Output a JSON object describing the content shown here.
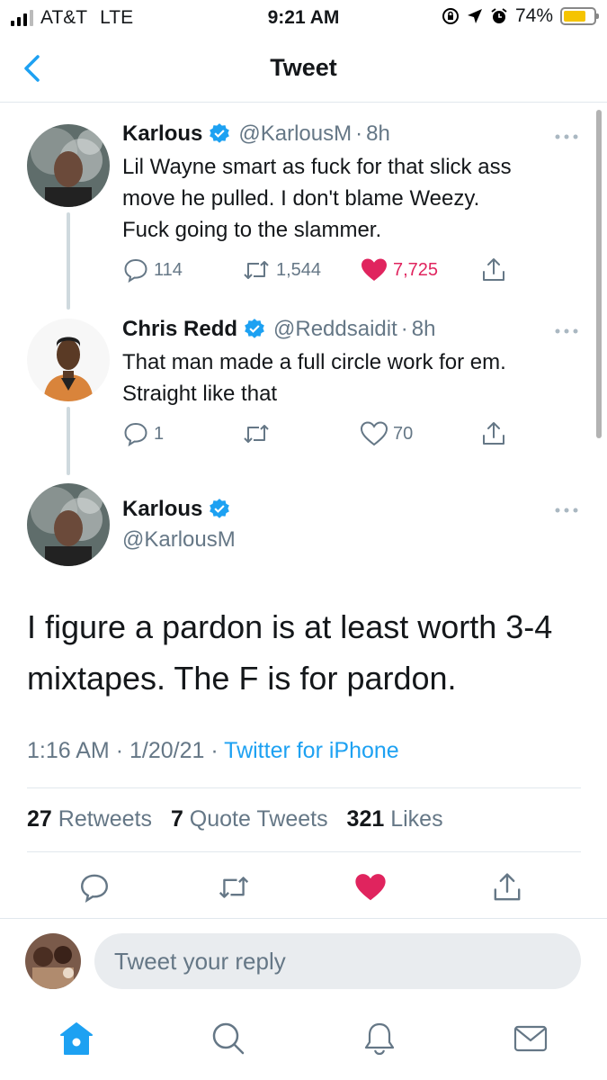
{
  "status_bar": {
    "carrier": "AT&T",
    "network": "LTE",
    "time": "9:21 AM",
    "battery": "74%"
  },
  "header": {
    "title": "Tweet",
    "back_icon": "chevron-left-icon"
  },
  "colors": {
    "accent": "#1da1f2",
    "like": "#e0245e",
    "secondary_text": "#657786",
    "primary_text": "#14171a"
  },
  "thread": [
    {
      "name": "Karlous",
      "handle": "@KarlousM",
      "separator": "·",
      "time": "8h",
      "text_lines": [
        "Lil Wayne smart as fuck for that slick ass",
        "move he pulled. I don't blame Weezy.",
        "Fuck going to the slammer."
      ],
      "replies": "114",
      "retweets": "1,544",
      "likes": "7,725",
      "liked": true
    },
    {
      "name": "Chris Redd",
      "handle": "@Reddsaidit",
      "separator": "·",
      "time": "8h",
      "text_lines": [
        "That man made a full circle work for em.",
        "Straight like that"
      ],
      "replies": "1",
      "retweets": "",
      "likes": "70",
      "liked": false
    }
  ],
  "main_tweet": {
    "name": "Karlous",
    "handle": "@KarlousM",
    "text_lines": [
      "I figure a pardon is at least worth 3-4",
      "mixtapes. The F is for pardon."
    ],
    "time": "1:16 AM",
    "date": "1/20/21",
    "separator": "·",
    "source": "Twitter for iPhone",
    "retweets_count": "27",
    "retweets_label": "Retweets",
    "quotes_count": "7",
    "quotes_label": "Quote Tweets",
    "likes_count": "321",
    "likes_label": "Likes",
    "liked": true
  },
  "reply": {
    "placeholder": "Tweet your reply"
  },
  "tabs": [
    "home-icon",
    "search-icon",
    "notifications-bell-icon",
    "messages-envelope-icon"
  ]
}
